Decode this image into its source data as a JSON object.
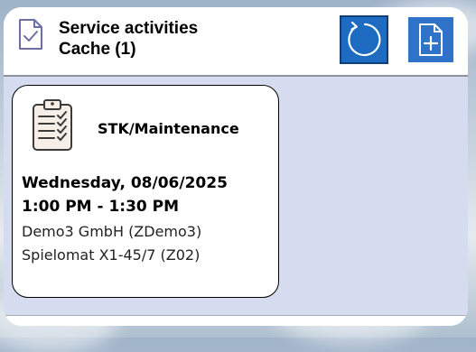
{
  "header": {
    "title": "Service activities",
    "subtitle": "Cache (1)",
    "refresh_icon": "refresh-icon",
    "new_icon": "new-document-icon",
    "header_icon": "document-check-icon"
  },
  "colors": {
    "accent": "#1e6cc2",
    "gallery_background": "#d6dcef",
    "card_background": "#ffffff"
  },
  "activities": [
    {
      "type": "STK/Maintenance",
      "icon": "clipboard-checklist-icon",
      "date": "Wednesday, 08/06/2025",
      "time": "1:00 PM - 1:30 PM",
      "customer": "Demo3 GmbH (ZDemo3)",
      "machine": "Spielomat X1-45/7 (Z02)"
    }
  ]
}
